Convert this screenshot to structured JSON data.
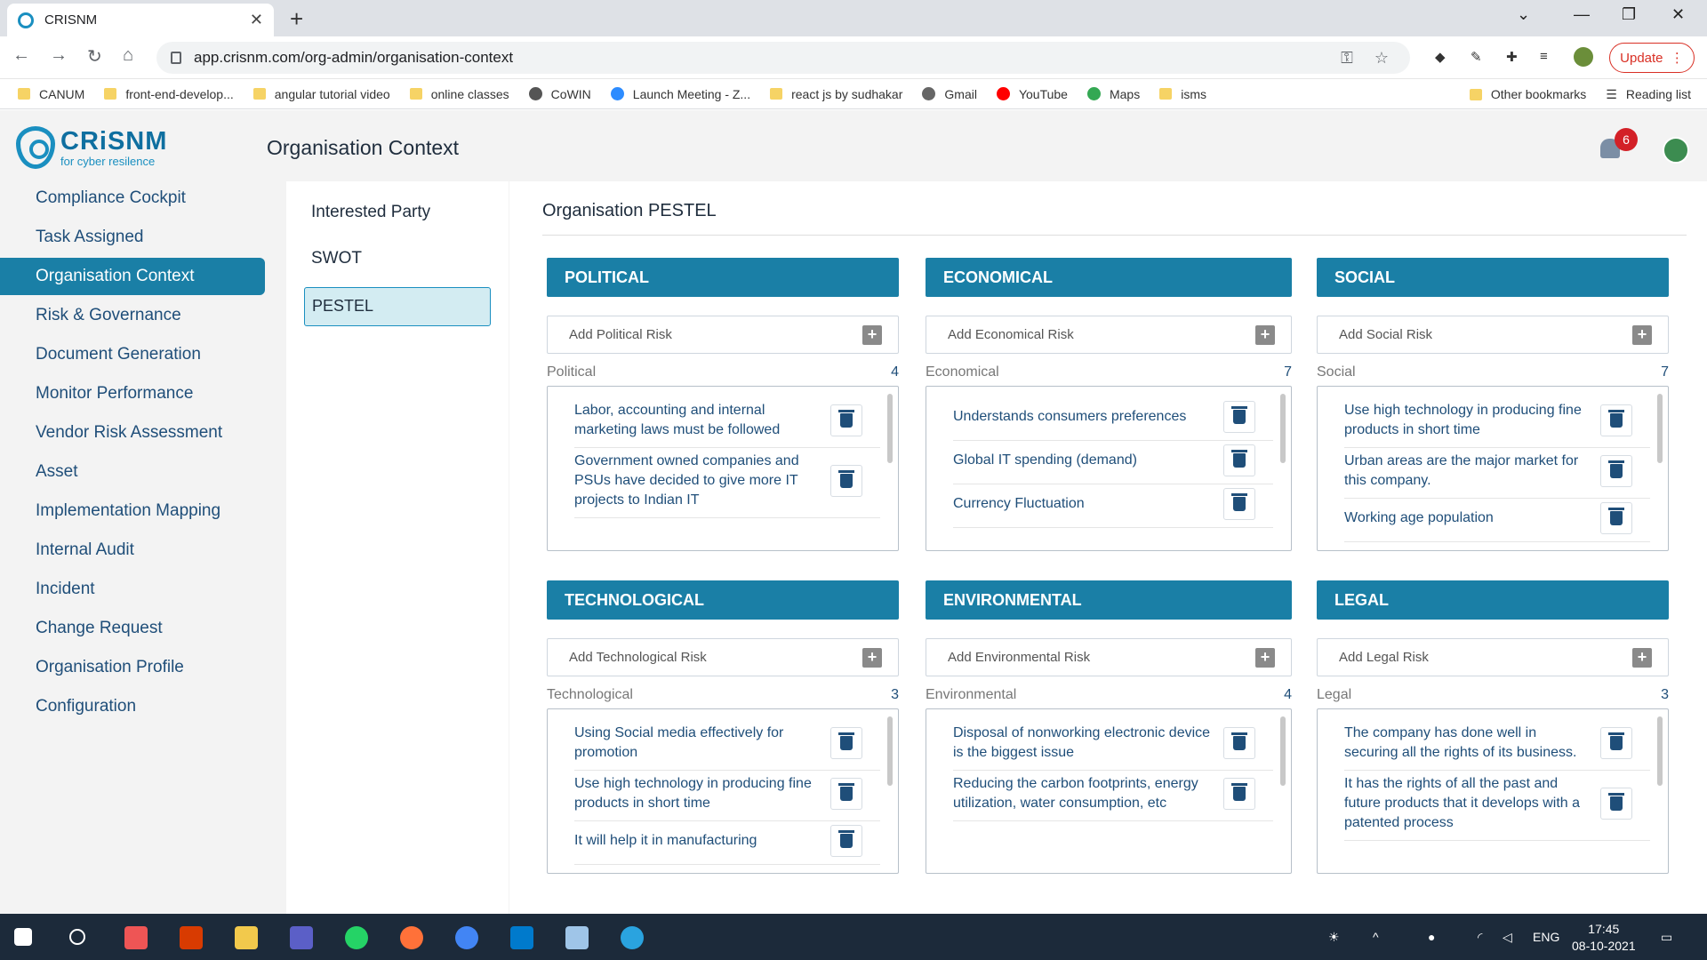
{
  "browser": {
    "tab_title": "CRISNM",
    "url": "app.crisnm.com/org-admin/organisation-context",
    "update_label": "Update",
    "bookmarks": [
      "CANUM",
      "front-end-develop...",
      "angular tutorial video",
      "online classes",
      "CoWIN",
      "Launch Meeting - Z...",
      "react js by sudhakar",
      "Gmail",
      "YouTube",
      "Maps",
      "isms"
    ],
    "other_bookmarks": "Other bookmarks",
    "reading_list": "Reading list"
  },
  "header": {
    "logo_name": "CRiSNM",
    "logo_tagline": "for cyber resilence",
    "page_title": "Organisation Context",
    "notification_count": "6"
  },
  "sidebar": [
    {
      "label": "Compliance Cockpit"
    },
    {
      "label": "Task Assigned"
    },
    {
      "label": "Organisation Context",
      "active": true
    },
    {
      "label": "Risk & Governance"
    },
    {
      "label": "Document Generation"
    },
    {
      "label": "Monitor Performance"
    },
    {
      "label": "Vendor Risk Assessment"
    },
    {
      "label": "Asset"
    },
    {
      "label": "Implementation Mapping"
    },
    {
      "label": "Internal Audit"
    },
    {
      "label": "Incident"
    },
    {
      "label": "Change Request"
    },
    {
      "label": "Organisation Profile"
    },
    {
      "label": "Configuration"
    }
  ],
  "subnav": [
    "Interested Party",
    "SWOT",
    "PESTEL"
  ],
  "section_title": "Organisation PESTEL",
  "cards": [
    {
      "title": "POLITICAL",
      "placeholder": "Add Political Risk",
      "label": "Political",
      "count": "4",
      "items": [
        "Labor, accounting and internal marketing laws must be followed",
        "Government owned companies and PSUs have decided to give more IT projects to Indian IT"
      ]
    },
    {
      "title": "ECONOMICAL",
      "placeholder": "Add Economical Risk",
      "label": "Economical",
      "count": "7",
      "items": [
        "Understands consumers preferences",
        "Global IT spending (demand)",
        "Currency Fluctuation"
      ]
    },
    {
      "title": "SOCIAL",
      "placeholder": "Add Social Risk",
      "label": "Social",
      "count": "7",
      "items": [
        "Use high technology in producing fine products in short time",
        "Urban areas are the major market for this company.",
        "Working age population"
      ]
    },
    {
      "title": "TECHNOLOGICAL",
      "placeholder": "Add Technological Risk",
      "label": "Technological",
      "count": "3",
      "items": [
        "Using Social media effectively for promotion",
        "Use high technology in producing fine products in short time",
        "It will help it in manufacturing"
      ]
    },
    {
      "title": "ENVIRONMENTAL",
      "placeholder": "Add Environmental Risk",
      "label": "Environmental",
      "count": "4",
      "items": [
        "Disposal of nonworking electronic device is the biggest issue",
        "Reducing the carbon footprints, energy utilization, water consumption, etc"
      ]
    },
    {
      "title": "LEGAL",
      "placeholder": "Add Legal Risk",
      "label": "Legal",
      "count": "3",
      "items": [
        "The company has done well in securing all the rights of its business.",
        "It has the rights of all the past and future products that it develops with a patented process"
      ]
    }
  ],
  "taskbar": {
    "lang": "ENG",
    "time": "17:45",
    "date": "08-10-2021"
  }
}
